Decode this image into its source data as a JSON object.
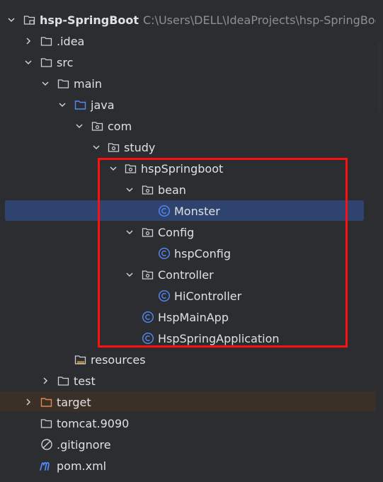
{
  "project": {
    "name": "hsp-SpringBoot",
    "path": "C:\\Users\\DELL\\IdeaProjects\\hsp-SpringBoot"
  },
  "tree": {
    "idea": ".idea",
    "src": "src",
    "main": "main",
    "java": "java",
    "com": "com",
    "study": "study",
    "hsp_springboot": "hspSpringboot",
    "bean": "bean",
    "monster": "Monster",
    "config": "Config",
    "hsp_config": "hspConfig",
    "controller": "Controller",
    "hi_controller": "HiController",
    "hsp_main_app": "HspMainApp",
    "hsp_spring_application": "HspSpringApplication",
    "resources": "resources",
    "test": "test",
    "target": "target",
    "tomcat": "tomcat.9090",
    "gitignore": ".gitignore",
    "pom": "pom.xml"
  },
  "colors": {
    "background": "#2b2d30",
    "selection": "#2e436e",
    "highlight_box": "#ff0f0f",
    "class_icon": "#548af7",
    "excluded_folder": "#e08855"
  }
}
